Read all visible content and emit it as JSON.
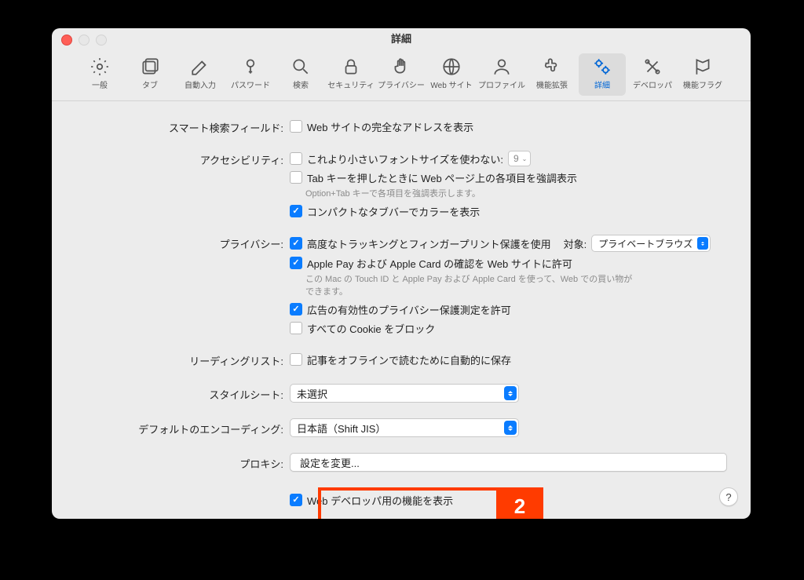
{
  "title": "詳細",
  "toolbar": [
    {
      "id": "general",
      "label": "一般"
    },
    {
      "id": "tabs",
      "label": "タブ"
    },
    {
      "id": "autofill",
      "label": "自動入力"
    },
    {
      "id": "passwords",
      "label": "パスワード"
    },
    {
      "id": "search",
      "label": "検索"
    },
    {
      "id": "security",
      "label": "セキュリティ"
    },
    {
      "id": "privacy",
      "label": "プライバシー"
    },
    {
      "id": "websites",
      "label": "Web サイト"
    },
    {
      "id": "profiles",
      "label": "プロファイル"
    },
    {
      "id": "extensions",
      "label": "機能拡張"
    },
    {
      "id": "advanced",
      "label": "詳細",
      "selected": true
    },
    {
      "id": "developer",
      "label": "デベロッパ"
    },
    {
      "id": "flags",
      "label": "機能フラグ"
    }
  ],
  "sections": {
    "smartSearch": {
      "label": "スマート検索フィールド:",
      "fullAddress": "Web サイトの完全なアドレスを表示"
    },
    "accessibility": {
      "label": "アクセシビリティ:",
      "noSmaller": "これより小さいフォントサイズを使わない:",
      "fontSize": "9",
      "tabHighlight": "Tab キーを押したときに Web ページ上の各項目を強調表示",
      "tabHint": "Option+Tab キーで各項目を強調表示します。",
      "compactColor": "コンパクトなタブバーでカラーを表示"
    },
    "privacy": {
      "label": "プライバシー:",
      "tracking": "高度なトラッキングとフィンガープリント保護を使用",
      "scopeLabel": "対象:",
      "scopeValue": "プライベートブラウズ",
      "applePay": "Apple Pay および Apple Card の確認を Web サイトに許可",
      "applePayHint": "この Mac の Touch ID と Apple Pay および Apple Card を使って、Web での買い物ができます。",
      "adMeasure": "広告の有効性のプライバシー保護測定を許可",
      "blockCookies": "すべての Cookie をブロック"
    },
    "readingList": {
      "label": "リーディングリスト:",
      "saveOffline": "記事をオフラインで読むために自動的に保存"
    },
    "styleSheet": {
      "label": "スタイルシート:",
      "value": "未選択"
    },
    "encoding": {
      "label": "デフォルトのエンコーディング:",
      "value": "日本語（Shift JIS）"
    },
    "proxies": {
      "label": "プロキシ:",
      "button": "設定を変更..."
    },
    "developer": {
      "label": "Web デベロッパ用の機能を表示"
    }
  },
  "annotation": {
    "number": "2"
  },
  "help": "?"
}
